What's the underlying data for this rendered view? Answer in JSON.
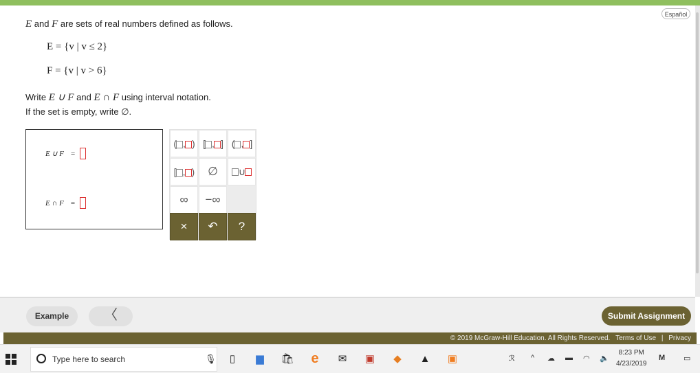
{
  "language_toggle": "Español",
  "question": {
    "intro_pre": "E",
    "intro_and": " and ",
    "intro_f": "F",
    "intro_post": " are sets of real numbers defined as follows.",
    "def_e": "E = {v | v ≤ 2}",
    "def_f": "F = {v | v > 6}",
    "instruction_1a": "Write ",
    "instruction_union": "E ∪ F",
    "instruction_and": " and ",
    "instruction_intersection": "E ∩ F",
    "instruction_1b": " using interval notation.",
    "instruction_2": "If the set is empty, write ∅."
  },
  "answers": {
    "union_label": "E ∪ F",
    "intersection_label": "E ∩ F",
    "equals": "="
  },
  "keypad": {
    "empty_set": "∅",
    "union_sym": "∪",
    "infinity": "∞",
    "neg_infinity": "−∞",
    "clear": "×",
    "undo": "↶",
    "help": "?"
  },
  "footer_nav": {
    "example_label": "Example",
    "back_icon": "〈",
    "submit_label": "Submit Assignment"
  },
  "footer": {
    "copyright": "© 2019 McGraw-Hill Education. All Rights Reserved.",
    "terms": "Terms of Use",
    "separator": "|",
    "privacy": "Privacy"
  },
  "taskbar": {
    "search_placeholder": "Type here to search",
    "time": "8:23 PM",
    "date": "4/23/2019"
  },
  "colors": {
    "accent_olive": "#6b6232",
    "top_green": "#8fbf5e",
    "slot_red": "#dd3333"
  }
}
